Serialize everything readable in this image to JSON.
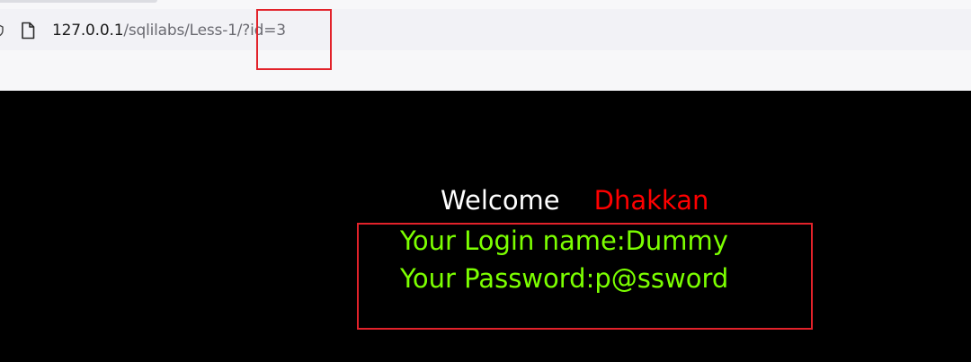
{
  "browser": {
    "url_host": "127.0.0.1",
    "url_path": "/sqlilabs/Less-1/?id=3",
    "icons": [
      "shield-icon",
      "page-icon"
    ]
  },
  "page": {
    "welcome_word": "Welcome",
    "welcome_name": "Dhakkan",
    "login_line": "Your Login name:Dummy",
    "password_line": "Your Password:p@ssword"
  },
  "colors": {
    "background": "#000000",
    "welcome": "#ffffff",
    "name": "#ff0000",
    "result_text": "#7cff00",
    "annotation_box": "#e2222a"
  }
}
